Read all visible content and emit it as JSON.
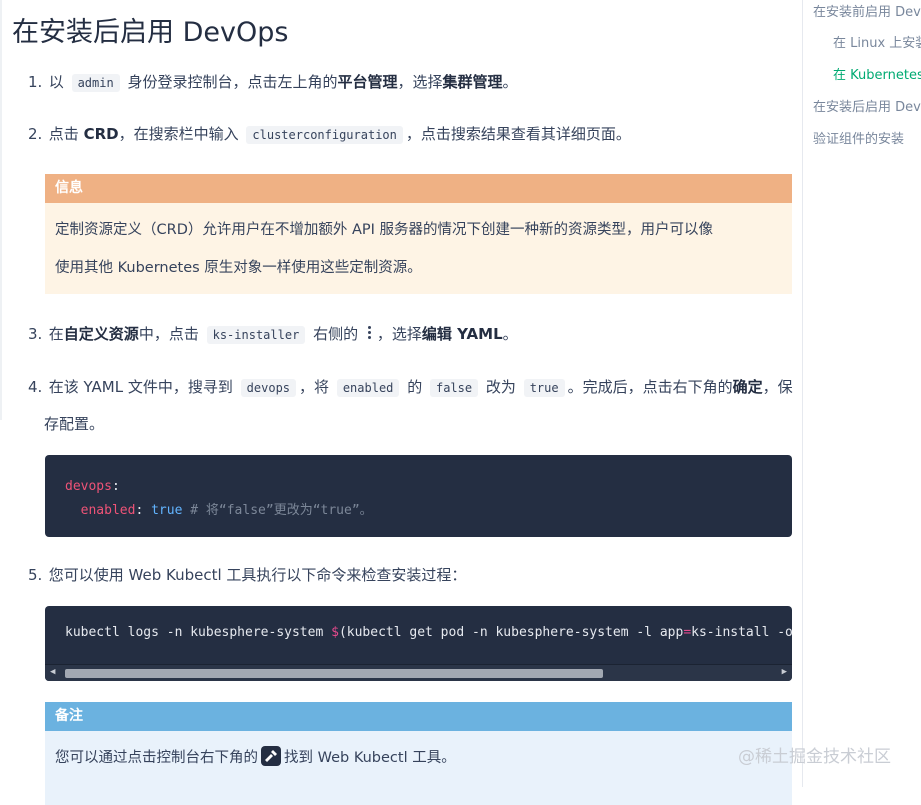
{
  "page": {
    "title": "在安装后启用 DevOps"
  },
  "steps": {
    "s1": {
      "num": "1.",
      "t1": "以",
      "code": "admin",
      "t2": "身份登录控制台，点击左上角的",
      "b1": "平台管理",
      "t3": "，选择",
      "b2": "集群管理",
      "t4": "。"
    },
    "s2": {
      "num": "2.",
      "t1": "点击",
      "b1": "CRD",
      "t2": "，在搜索栏中输入",
      "code": "clusterconfiguration",
      "t3": "，点击搜索结果查看其详细页面。"
    },
    "s3": {
      "num": "3.",
      "t1": "在",
      "b1": "自定义资源",
      "t2": "中，点击",
      "code": "ks-installer",
      "t3": "右侧的",
      "t4": "，选择",
      "b2": "编辑 YAML",
      "t5": "。"
    },
    "s4": {
      "num": "4.",
      "t1": "在该 YAML 文件中，搜寻到",
      "c1": "devops",
      "t2": "，将",
      "c2": "enabled",
      "t3": "的",
      "c3": "false",
      "t4": "改为",
      "c4": "true",
      "t5": "。完成后，点击右下角的",
      "b1": "确定",
      "t6": "，保",
      "t7": "存配置。"
    },
    "s5": {
      "num": "5.",
      "t1": "您可以使用 Web Kubectl 工具执行以下命令来检查安装过程："
    }
  },
  "info": {
    "label": "信息",
    "line1": "定制资源定义（CRD）允许用户在不增加额外 API 服务器的情况下创建一种新的资源类型，用户可以像",
    "line2": "使用其他 Kubernetes 原生对象一样使用这些定制资源。"
  },
  "yaml": {
    "key1": "devops",
    "colon1": ":",
    "key2": "enabled",
    "colon2": ":",
    "value": "true",
    "comment": "# 将“false”更改为“true”。"
  },
  "command": {
    "part1": "kubectl logs -n kubesphere-system ",
    "dollar": "$",
    "part2": "(kubectl get pod -n kubesphere-system -l app",
    "eq": "=",
    "part3": "ks-install -o j"
  },
  "note": {
    "label": "备注",
    "t1": "您可以通过点击控制台右下角的",
    "t2": "找到 Web Kubectl 工具。"
  },
  "toc": [
    {
      "label": "在安装前启用 DevOps",
      "active": false
    },
    {
      "label": "在 Linux 上安装",
      "active": false
    },
    {
      "label": "在 Kubernetes 上安装",
      "active": true
    },
    {
      "label": "在安装后启用 DevOps",
      "active": false
    },
    {
      "label": "验证组件的安装",
      "active": false
    }
  ],
  "watermark": "@稀土掘金技术社区",
  "icons": {
    "kebab": "more-vertical-icon",
    "kubectl": "hammer-icon"
  },
  "colors": {
    "info_header": "#efb184",
    "info_bg": "#fef4e5",
    "note_header": "#6bb2e0",
    "note_bg": "#e9f2fb",
    "code_bg": "#242e42",
    "toc_active": "#00aa72"
  }
}
